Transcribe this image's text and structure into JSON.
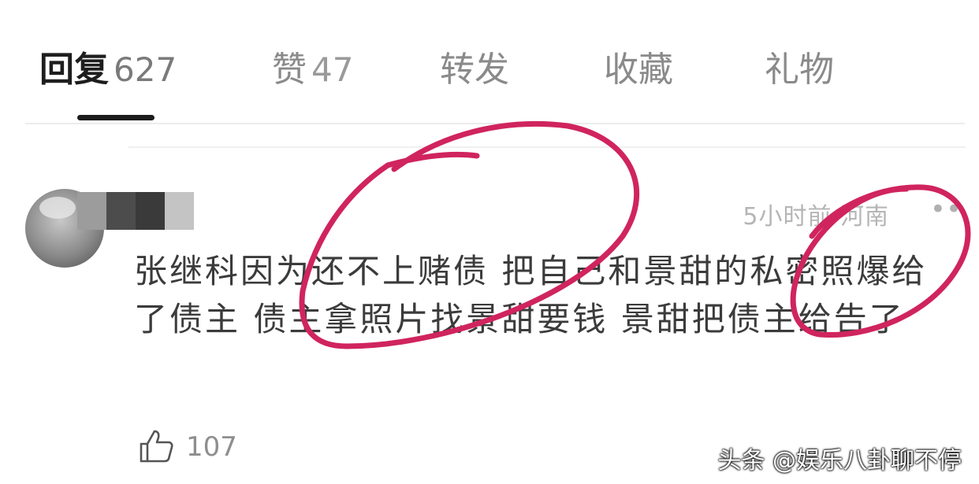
{
  "tabs": [
    {
      "label": "回复",
      "count": "627"
    },
    {
      "label": "赞",
      "count": "47"
    },
    {
      "label": "转发",
      "count": ""
    },
    {
      "label": "收藏",
      "count": ""
    },
    {
      "label": "礼物",
      "count": ""
    }
  ],
  "comment": {
    "time_location": "5小时前 河南",
    "more_glyph": "••",
    "text": "张继科因为还不上赌债 把自己和景甜的私密照爆给了债主 债主拿照片找景甜要钱 景甜把债主给告了",
    "likes": "107"
  },
  "watermark": "头条 @娱乐八卦聊不停",
  "icons": {
    "like": "thumbs-up-icon",
    "more": "more-dots-icon",
    "avatar": "avatar"
  },
  "colors": {
    "annotation_circle": "#d0245f",
    "indicator": "#1c1c1c"
  }
}
